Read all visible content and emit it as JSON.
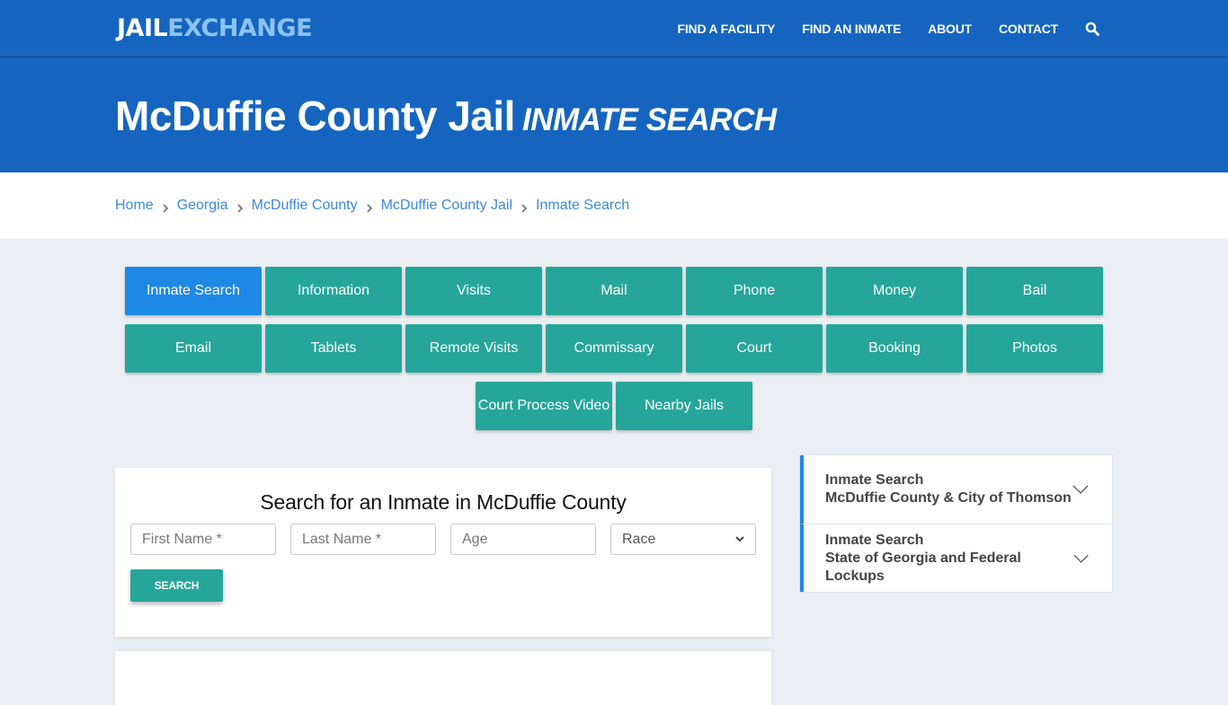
{
  "header": {
    "logo_part1": "JAIL",
    "logo_part2": "EXCHANGE",
    "nav": [
      {
        "label": "FIND A FACILITY"
      },
      {
        "label": "FIND AN INMATE"
      },
      {
        "label": "ABOUT"
      },
      {
        "label": "CONTACT"
      }
    ],
    "search_icon": "search-icon"
  },
  "hero": {
    "title": "McDuffie County Jail",
    "subtitle": "INMATE SEARCH"
  },
  "breadcrumb": [
    {
      "label": "Home"
    },
    {
      "label": "Georgia"
    },
    {
      "label": "McDuffie County"
    },
    {
      "label": "McDuffie County Jail"
    },
    {
      "label": "Inmate Search"
    }
  ],
  "tiles": {
    "row1": [
      "Inmate Search",
      "Information",
      "Visits",
      "Mail",
      "Phone",
      "Money",
      "Bail"
    ],
    "row2": [
      "Email",
      "Tablets",
      "Remote Visits",
      "Commissary",
      "Court",
      "Booking",
      "Photos"
    ],
    "row3": [
      "Court Process Video",
      "Nearby Jails"
    ],
    "active": "Inmate Search"
  },
  "search_form": {
    "heading": "Search for an Inmate in McDuffie County",
    "first_name_placeholder": "First Name *",
    "last_name_placeholder": "Last Name *",
    "age_placeholder": "Age",
    "race_selected": "Race",
    "button_label": "SEARCH"
  },
  "sidebar": {
    "items": [
      {
        "line1": "Inmate Search",
        "line2": "McDuffie County & City of Thomson"
      },
      {
        "line1": "Inmate Search",
        "line2": "State of Georgia and Federal Lockups"
      }
    ]
  },
  "colors": {
    "brand_blue": "#1565c0",
    "logo_accent": "#8cc2f5",
    "tile_teal": "#26a69a",
    "tile_active": "#1e88e5",
    "link_blue": "#3b8ad8"
  }
}
